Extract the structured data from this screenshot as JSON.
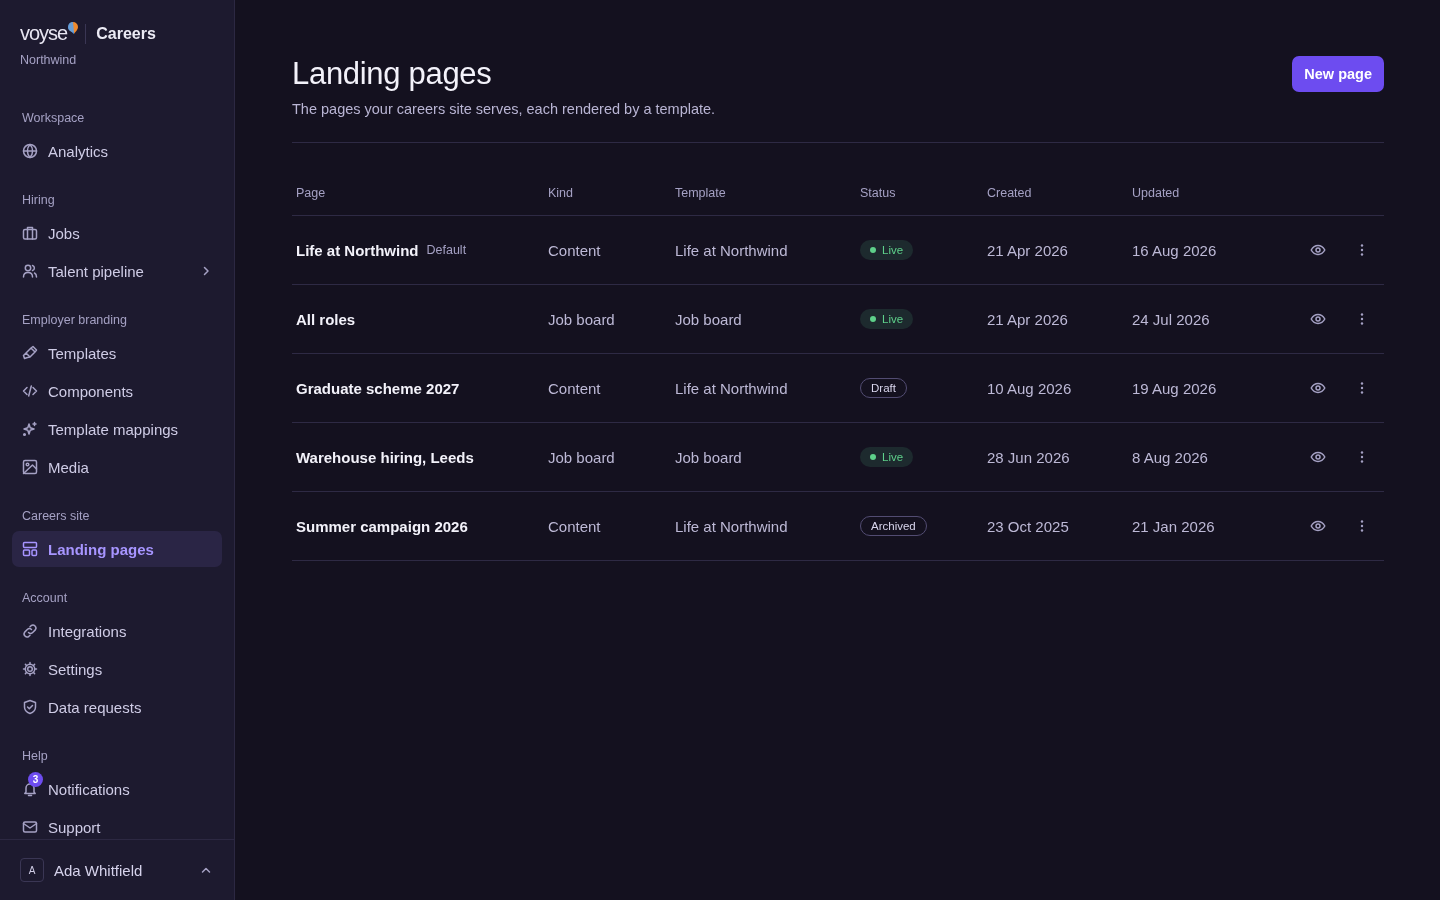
{
  "brand": {
    "logo": "voyse",
    "product": "Careers",
    "org": "Northwind"
  },
  "sidebar": {
    "sections": [
      {
        "label": "Workspace",
        "items": [
          {
            "label": "Analytics",
            "selected": false
          }
        ]
      },
      {
        "label": "Hiring",
        "items": [
          {
            "label": "Jobs",
            "selected": false
          },
          {
            "label": "Talent pipeline",
            "selected": false,
            "submenu": true
          }
        ]
      },
      {
        "label": "Employer branding",
        "items": [
          {
            "label": "Templates",
            "selected": false
          },
          {
            "label": "Components",
            "selected": false
          },
          {
            "label": "Template mappings",
            "selected": false
          },
          {
            "label": "Media",
            "selected": false
          }
        ]
      },
      {
        "label": "Careers site",
        "items": [
          {
            "label": "Landing pages",
            "selected": true
          }
        ]
      },
      {
        "label": "Account",
        "items": [
          {
            "label": "Integrations",
            "selected": false
          },
          {
            "label": "Settings",
            "selected": false
          },
          {
            "label": "Data requests",
            "selected": false
          }
        ]
      },
      {
        "label": "Help",
        "items": [
          {
            "label": "Notifications",
            "selected": false,
            "badge": "3"
          },
          {
            "label": "Support",
            "selected": false
          }
        ]
      }
    ],
    "user": {
      "initial": "A",
      "name": "Ada Whitfield",
      "expanded": true
    }
  },
  "header": {
    "title": "Landing pages",
    "subtitle": "The pages your careers site serves, each rendered by a template.",
    "button": "New page"
  },
  "table": {
    "columns": [
      "Page",
      "Kind",
      "Template",
      "Status",
      "Created",
      "Updated"
    ],
    "rows": [
      {
        "page": "Life at Northwind",
        "tag": "Default",
        "kind": "Content",
        "template": "Life at Northwind",
        "status": {
          "label": "Live",
          "kind": "live"
        },
        "created": "21 Apr 2026",
        "updated": "16 Aug 2026"
      },
      {
        "page": "All roles",
        "kind": "Job board",
        "template": "Job board",
        "status": {
          "label": "Live",
          "kind": "live"
        },
        "created": "21 Apr 2026",
        "updated": "24 Jul 2026"
      },
      {
        "page": "Graduate scheme 2027",
        "kind": "Content",
        "template": "Life at Northwind",
        "status": {
          "label": "Draft",
          "kind": "draft"
        },
        "created": "10 Aug 2026",
        "updated": "19 Aug 2026"
      },
      {
        "page": "Warehouse hiring, Leeds",
        "kind": "Job board",
        "template": "Job board",
        "status": {
          "label": "Live",
          "kind": "live"
        },
        "created": "28 Jun 2026",
        "updated": "8 Aug 2026"
      },
      {
        "page": "Summer campaign 2026",
        "kind": "Content",
        "template": "Life at Northwind",
        "status": {
          "label": "Archived",
          "kind": "archived"
        },
        "created": "23 Oct 2025",
        "updated": "21 Jan 2026"
      }
    ]
  }
}
